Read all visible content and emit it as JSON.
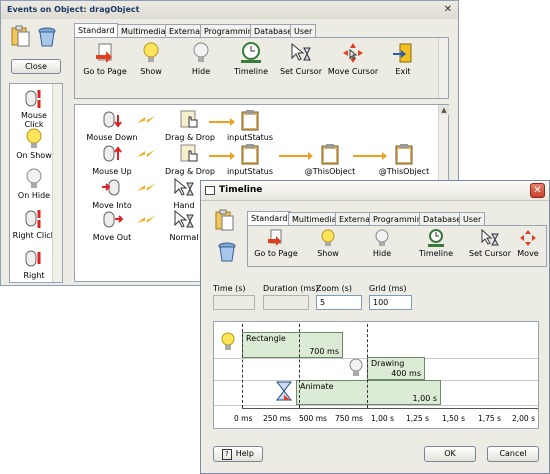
{
  "events_window": {
    "title": "Events on Object: dragObject",
    "close_button": "Close",
    "close_glyph": "✕",
    "tabs": [
      "Standard",
      "Multimedia",
      "External",
      "Programming",
      "Database",
      "User"
    ],
    "tools": [
      "Go to Page",
      "Show",
      "Hide",
      "Timeline",
      "Set Cursor",
      "Move Cursor",
      "Exit"
    ],
    "left_items": [
      "Mouse Click",
      "On Show",
      "On Hide",
      "Right Click",
      "Right"
    ],
    "events": [
      {
        "event": "Mouse Down",
        "action": "Drag & Drop",
        "target": "inputStatus"
      },
      {
        "event": "Mouse Up",
        "action": "Drag & Drop",
        "target": "inputStatus",
        "target2": "@ThisObject",
        "target3": "@ThisObject"
      },
      {
        "event": "Move Into",
        "action": "Hand"
      },
      {
        "event": "Move Out",
        "action": "Normal"
      }
    ]
  },
  "timeline_window": {
    "title": "Timeline",
    "tabs": [
      "Standard",
      "Multimedia",
      "External",
      "Programming",
      "Database",
      "User"
    ],
    "tools": [
      "Go to Page",
      "Show",
      "Hide",
      "Timeline",
      "Set Cursor",
      "Move"
    ],
    "fields": {
      "time_label": "Time (s)",
      "time_value": "",
      "duration_label": "Duration (ms)",
      "duration_value": "",
      "zoom_label": "Zoom (s)",
      "zoom_value": "5",
      "grid_label": "Grid (ms)",
      "grid_value": "100"
    },
    "tracks": [
      {
        "name": "Rectangle",
        "duration": "700 ms"
      },
      {
        "name": "Drawing",
        "duration": "400 ms"
      },
      {
        "name": "Animate",
        "duration": "1,00 s"
      }
    ],
    "ticks": [
      "0 ms",
      "250 ms",
      "500 ms",
      "750 ms",
      "1,00 s",
      "1,25 s",
      "1,50 s",
      "1,75 s",
      "2,00 s"
    ],
    "help_button": "Help",
    "ok_button": "OK",
    "cancel_button": "Cancel"
  }
}
